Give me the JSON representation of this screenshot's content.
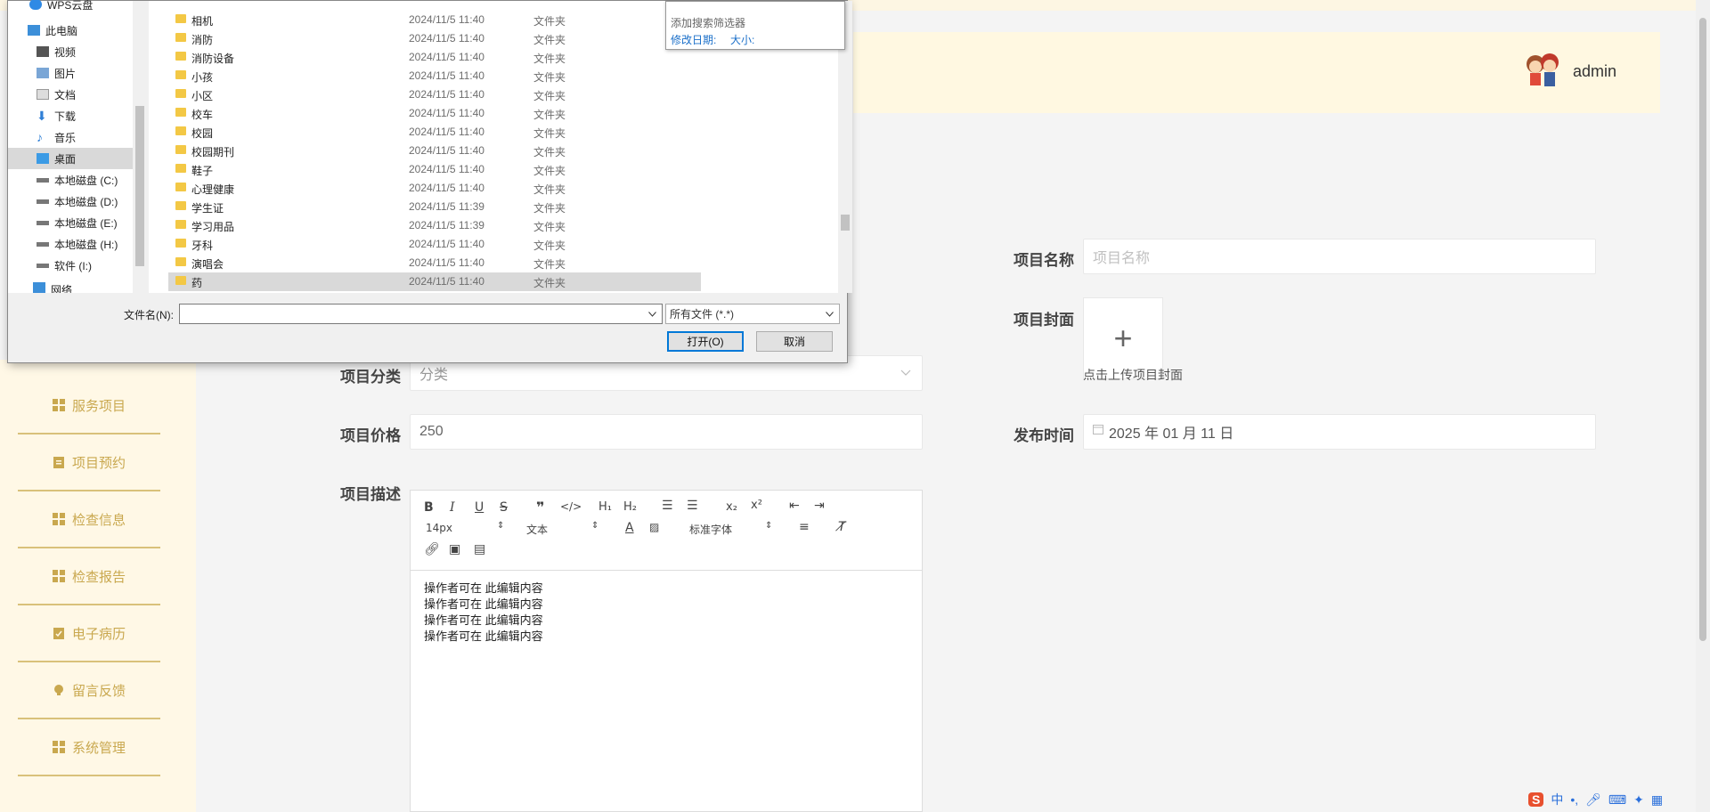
{
  "header": {
    "admin_name": "admin"
  },
  "sidebar": {
    "items": [
      {
        "label": "服务项目",
        "icon": "grid-icon"
      },
      {
        "label": "项目预约",
        "icon": "clipboard-icon"
      },
      {
        "label": "检查信息",
        "icon": "grid-icon"
      },
      {
        "label": "检查报告",
        "icon": "grid-icon"
      },
      {
        "label": "电子病历",
        "icon": "clipboard-check-icon"
      },
      {
        "label": "留言反馈",
        "icon": "bulb-icon"
      },
      {
        "label": "系统管理",
        "icon": "grid-icon"
      }
    ]
  },
  "form": {
    "name_label": "项目名称",
    "name_placeholder": "项目名称",
    "cover_label": "项目封面",
    "cover_hint": "点击上传项目封面",
    "category_label": "项目分类",
    "category_placeholder": "分类",
    "price_label": "项目价格",
    "price_value": "250",
    "publish_label": "发布时间",
    "publish_value": "2025 年 01 月 11 日",
    "desc_label": "项目描述"
  },
  "editor": {
    "font_size": "14px",
    "text_style": "文本",
    "font_family": "标准字体",
    "content_lines": [
      "操作者可在 此编辑内容",
      "操作者可在 此编辑内容",
      "操作者可在 此编辑内容",
      "操作者可在 此编辑内容"
    ]
  },
  "dialog": {
    "nav_items": [
      {
        "label": "WPS云盘",
        "icon": "cloud-icon"
      },
      {
        "label": "此电脑",
        "icon": "computer-icon"
      },
      {
        "label": "视频",
        "icon": "video-icon"
      },
      {
        "label": "图片",
        "icon": "picture-icon"
      },
      {
        "label": "文档",
        "icon": "document-icon"
      },
      {
        "label": "下载",
        "icon": "download-icon"
      },
      {
        "label": "音乐",
        "icon": "music-icon"
      },
      {
        "label": "桌面",
        "icon": "desktop-icon"
      },
      {
        "label": "本地磁盘 (C:)",
        "icon": "drive-icon"
      },
      {
        "label": "本地磁盘 (D:)",
        "icon": "drive-icon"
      },
      {
        "label": "本地磁盘 (E:)",
        "icon": "drive-icon"
      },
      {
        "label": "本地磁盘 (H:)",
        "icon": "drive-icon"
      },
      {
        "label": "软件 (I:)",
        "icon": "drive-icon"
      },
      {
        "label": "网络",
        "icon": "network-icon"
      }
    ],
    "files": [
      {
        "name": "相机",
        "date": "2024/11/5 11:40",
        "type": "文件夹"
      },
      {
        "name": "消防",
        "date": "2024/11/5 11:40",
        "type": "文件夹"
      },
      {
        "name": "消防设备",
        "date": "2024/11/5 11:40",
        "type": "文件夹"
      },
      {
        "name": "小孩",
        "date": "2024/11/5 11:40",
        "type": "文件夹"
      },
      {
        "name": "小区",
        "date": "2024/11/5 11:40",
        "type": "文件夹"
      },
      {
        "name": "校车",
        "date": "2024/11/5 11:40",
        "type": "文件夹"
      },
      {
        "name": "校园",
        "date": "2024/11/5 11:40",
        "type": "文件夹"
      },
      {
        "name": "校园期刊",
        "date": "2024/11/5 11:40",
        "type": "文件夹"
      },
      {
        "name": "鞋子",
        "date": "2024/11/5 11:40",
        "type": "文件夹"
      },
      {
        "name": "心理健康",
        "date": "2024/11/5 11:40",
        "type": "文件夹"
      },
      {
        "name": "学生证",
        "date": "2024/11/5 11:39",
        "type": "文件夹"
      },
      {
        "name": "学习用品",
        "date": "2024/11/5 11:39",
        "type": "文件夹"
      },
      {
        "name": "牙科",
        "date": "2024/11/5 11:40",
        "type": "文件夹"
      },
      {
        "name": "演唱会",
        "date": "2024/11/5 11:40",
        "type": "文件夹"
      },
      {
        "name": "药",
        "date": "2024/11/5 11:40",
        "type": "文件夹"
      }
    ],
    "search_popup": {
      "text": "添加搜索筛选器",
      "filter_date": "修改日期:",
      "filter_size": "大小:"
    },
    "filename_label": "文件名(N):",
    "filename_value": "",
    "filetype": "所有文件 (*.*)",
    "open_button": "打开(O)",
    "cancel_button": "取消"
  }
}
